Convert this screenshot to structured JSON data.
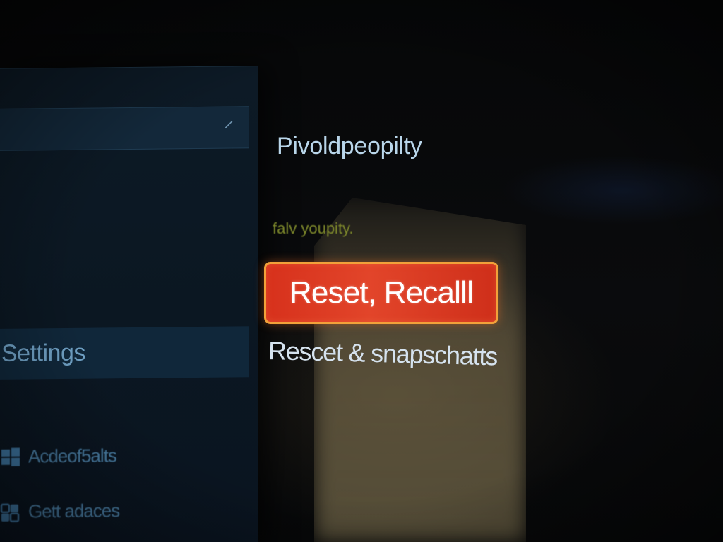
{
  "sidebar": {
    "address_bar_value": "",
    "settings_label": "Settings",
    "items": [
      {
        "label": "Acdeof5alts",
        "icon": "windows-icon"
      },
      {
        "label": "Gett adaces",
        "icon": "apps-icon"
      }
    ]
  },
  "main": {
    "section_title": "Pivoldpeopilty",
    "section_description": "falv youpity.",
    "primary_button_label": "Reset, Recalll",
    "secondary_link_label": "Rescet & snapschatts"
  },
  "colors": {
    "button_fill": "#d7311c",
    "button_border": "#f2a13a",
    "description_text": "#7f8a2c",
    "sidebar_text": "#4a7fa6",
    "title_text": "#b9d6ea"
  }
}
